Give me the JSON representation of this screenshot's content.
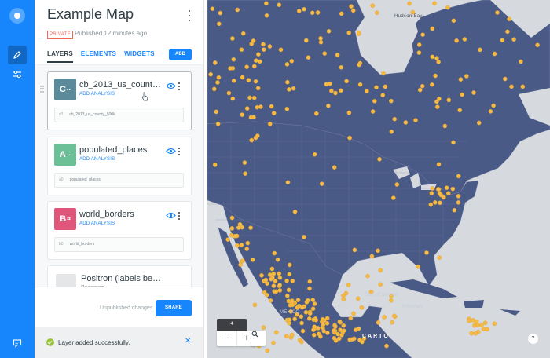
{
  "app": {
    "accent_color": "#1785fb",
    "rail": {
      "logo_icon": "carto-logo-icon",
      "tools": [
        "pencil-icon",
        "sliders-icon"
      ],
      "bottom_icon": "chat-icon"
    }
  },
  "editor": {
    "title": "Example Map",
    "privacy": "PRIVATE",
    "published": "Published 12 minutes ago",
    "tabs": [
      {
        "label": "LAYERS",
        "active": true
      },
      {
        "label": "ELEMENTS",
        "active": false
      },
      {
        "label": "WIDGETS",
        "active": false
      }
    ],
    "add_label": "ADD",
    "layers": [
      {
        "letter": "C",
        "symbol": "··",
        "color": "#5b8a9a",
        "name": "cb_2013_us_county_500k",
        "analysis_label": "ADD ANALYSIS",
        "source_id": "c0",
        "source_name": "cb_2013_us_county_500k"
      },
      {
        "letter": "A",
        "symbol": "··",
        "color": "#6cc098",
        "name": "populated_places",
        "analysis_label": "ADD ANALYSIS",
        "source_id": "a0",
        "source_name": "populated_places"
      },
      {
        "letter": "B",
        "symbol": "⌗",
        "color": "#e0567b",
        "name": "world_borders",
        "analysis_label": "ADD ANALYSIS",
        "source_id": "b0",
        "source_name": "world_borders"
      }
    ],
    "basemap": {
      "name": "Positron (labels below)",
      "type": "Basemap"
    },
    "unpublished": "Unpublished changes",
    "share_label": "SHARE",
    "toast": "Layer added successfully."
  },
  "map": {
    "labels": [
      "Hudson Bay",
      "Gulf of Mexico",
      "HAVANA",
      "MEXICO"
    ],
    "zoom_level": "4",
    "zoom_out": "−",
    "zoom_in": "+",
    "attribution": "CARTO",
    "help": "?",
    "colors": {
      "land": "#4a5a86",
      "water": "#d6d9de",
      "points": "#f5b945"
    }
  }
}
